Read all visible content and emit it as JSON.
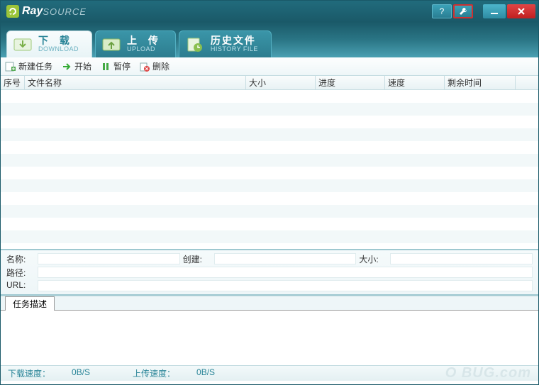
{
  "app": {
    "name_bold": "Ray",
    "name_light": "SOURCE"
  },
  "titlebar": {
    "help": "?",
    "settings_icon": "settings",
    "min_icon": "min",
    "close_icon": "close"
  },
  "tabs": {
    "download": {
      "title": "下 载",
      "sub": "DOWNLOAD"
    },
    "upload": {
      "title": "上 传",
      "sub": "UPLOAD"
    },
    "history": {
      "title": "历史文件",
      "sub": "HISTORY FILE"
    }
  },
  "toolbar": {
    "new_task": "新建任务",
    "start": "开始",
    "pause": "暂停",
    "delete": "删除"
  },
  "columns": {
    "seq": "序号",
    "filename": "文件名称",
    "size": "大小",
    "progress": "进度",
    "speed": "速度",
    "remaining": "剩余时间"
  },
  "details": {
    "name_label": "名称:",
    "created_label": "创建:",
    "size_label": "大小:",
    "path_label": "路径:",
    "url_label": "URL:",
    "name": "",
    "created": "",
    "size": "",
    "path": "",
    "url": ""
  },
  "desc_tab": "任务描述",
  "status": {
    "down_label": "下载速度：",
    "down_value": "0B/S",
    "up_label": "上传速度：",
    "up_value": "0B/S"
  },
  "watermark": "O BUG.com"
}
